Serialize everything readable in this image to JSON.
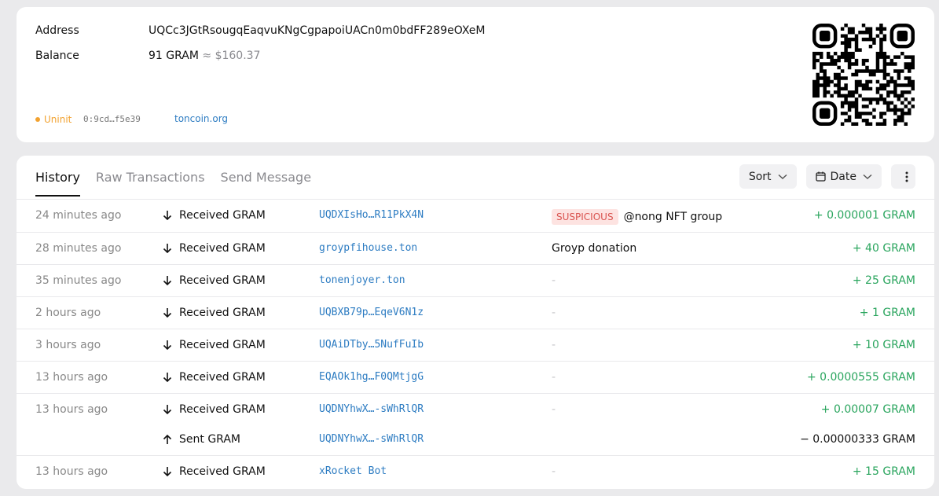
{
  "wallet": {
    "address_label": "Address",
    "address_value": "UQCc3JGtRsougqEaqvuKNgCgpapoiUACn0m0bdFF289eOXeM",
    "balance_label": "Balance",
    "balance_value": "91 GRAM",
    "balance_usd": "≈ $160.37",
    "status": "Uninit",
    "status_color": "#f2a230",
    "hash": "0:9cd…f5e39",
    "site_link": "toncoin.org",
    "qr_icon": "qr-code"
  },
  "tabs": [
    {
      "label": "History",
      "active": true
    },
    {
      "label": "Raw Transactions",
      "active": false
    },
    {
      "label": "Send Message",
      "active": false
    }
  ],
  "toolbar": {
    "sort_label": "Sort",
    "date_label": "Date",
    "more_icon": "kebab-menu-icon"
  },
  "colors": {
    "accent_link": "#2d7cc2",
    "positive": "#2aa55e",
    "suspicious_bg": "#fde3e1",
    "suspicious_text": "#d9534f"
  },
  "transactions": [
    {
      "time": "24 minutes ago",
      "direction": "in",
      "type": "Received GRAM",
      "address": "UQDXIsHo…R11PkX4N",
      "badge": "SUSPICIOUS",
      "comment": "@nong NFT group",
      "amount": "+ 0.000001 GRAM"
    },
    {
      "time": "28 minutes ago",
      "direction": "in",
      "type": "Received GRAM",
      "address": "groypfihouse.ton",
      "comment": "Groyp donation",
      "amount": "+ 40 GRAM"
    },
    {
      "time": "35 minutes ago",
      "direction": "in",
      "type": "Received GRAM",
      "address": "tonenjoyer.ton",
      "comment": "-",
      "amount": "+ 25 GRAM"
    },
    {
      "time": "2 hours ago",
      "direction": "in",
      "type": "Received GRAM",
      "address": "UQBXB79p…EqeV6N1z",
      "comment": "-",
      "amount": "+ 1 GRAM"
    },
    {
      "time": "3 hours ago",
      "direction": "in",
      "type": "Received GRAM",
      "address": "UQAiDTby…5NufFuIb",
      "comment": "-",
      "amount": "+ 10 GRAM"
    },
    {
      "time": "13 hours ago",
      "direction": "in",
      "type": "Received GRAM",
      "address": "EQAOk1hg…F0QMtjgG",
      "comment": "-",
      "amount": "+ 0.0000555 GRAM"
    },
    {
      "time": "13 hours ago",
      "direction": "in",
      "type": "Received GRAM",
      "address": "UQDNYhwX…-sWhRlQR",
      "comment": "-",
      "amount": "+ 0.00007 GRAM"
    },
    {
      "time": "",
      "direction": "out",
      "type": "Sent GRAM",
      "address": "UQDNYhwX…-sWhRlQR",
      "comment": "",
      "amount": "− 0.00000333 GRAM"
    },
    {
      "time": "13 hours ago",
      "direction": "in",
      "type": "Received GRAM",
      "address": "xRocket Bot",
      "comment": "-",
      "amount": "+ 15 GRAM"
    }
  ]
}
